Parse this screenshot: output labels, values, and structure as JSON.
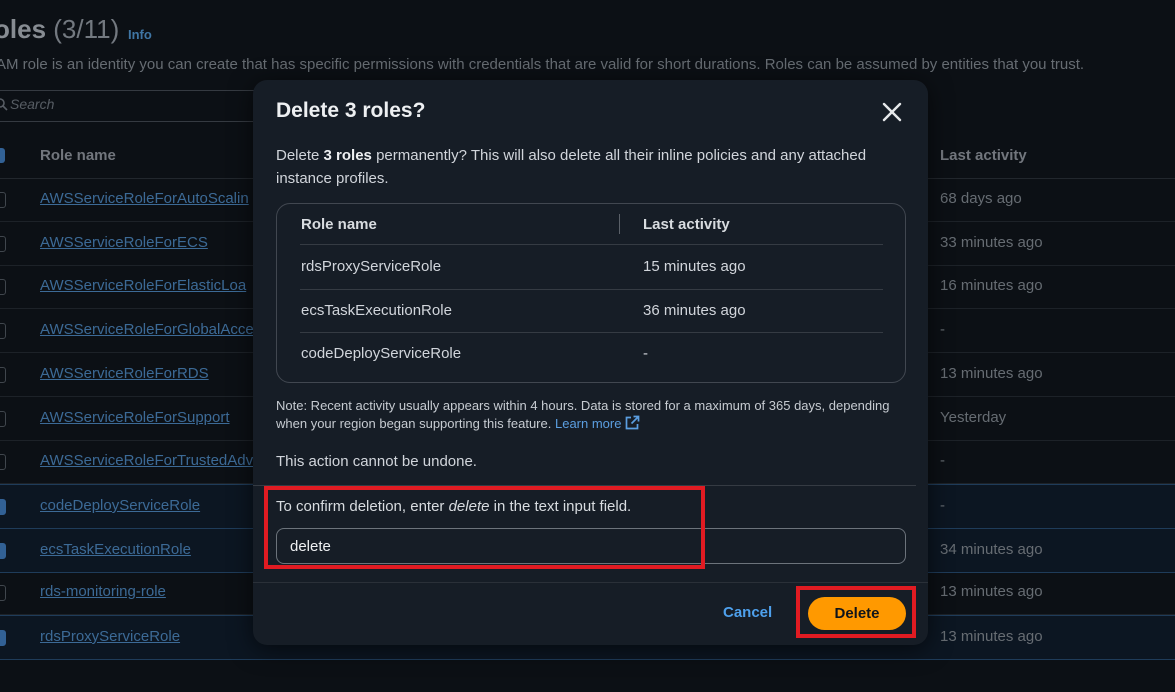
{
  "page": {
    "title": "oles",
    "count": "(3/11)",
    "info_link": "Info",
    "description": "AM role is an identity you can create that has specific permissions with credentials that are valid for short durations. Roles can be assumed by entities that you trust.",
    "search_placeholder": "Search",
    "columns": {
      "role_name": "Role name",
      "last_activity": "Last activity"
    },
    "rows": [
      {
        "name": "AWSServiceRoleForAutoScalin",
        "activity": "68 days ago",
        "selected": false
      },
      {
        "name": "AWSServiceRoleForECS",
        "activity": "33 minutes ago",
        "selected": false
      },
      {
        "name": "AWSServiceRoleForElasticLoa",
        "activity": "16 minutes ago",
        "selected": false
      },
      {
        "name": "AWSServiceRoleForGlobalAcce",
        "activity": "-",
        "selected": false
      },
      {
        "name": "AWSServiceRoleForRDS",
        "activity": "13 minutes ago",
        "selected": false
      },
      {
        "name": "AWSServiceRoleForSupport",
        "activity": "Yesterday",
        "selected": false
      },
      {
        "name": "AWSServiceRoleForTrustedAdv",
        "activity": "-",
        "selected": false
      },
      {
        "name": "codeDeployServiceRole",
        "activity": "-",
        "selected": true
      },
      {
        "name": "ecsTaskExecutionRole",
        "activity": "34 minutes ago",
        "selected": true
      },
      {
        "name": "rds-monitoring-role",
        "activity": "13 minutes ago",
        "selected": false
      },
      {
        "name": "rdsProxyServiceRole",
        "activity": "13 minutes ago",
        "selected": true
      }
    ]
  },
  "modal": {
    "title": "Delete 3 roles?",
    "body_prefix": "Delete ",
    "body_bold": "3 roles",
    "body_suffix": " permanently? This will also delete all their inline policies and any attached instance profiles.",
    "table": {
      "col_role": "Role name",
      "col_activity": "Last activity",
      "rows": [
        {
          "name": "rdsProxyServiceRole",
          "activity": "15 minutes ago"
        },
        {
          "name": "ecsTaskExecutionRole",
          "activity": "36 minutes ago"
        },
        {
          "name": "codeDeployServiceRole",
          "activity": "-"
        }
      ]
    },
    "note": "Note: Recent activity usually appears within 4 hours. Data is stored for a maximum of 365 days, depending when your region began supporting this feature.",
    "learn_more": "Learn more",
    "undone": "This action cannot be undone.",
    "confirm_prefix": "To confirm deletion, enter ",
    "confirm_word": "delete",
    "confirm_suffix": " in the text input field.",
    "input_value": "delete",
    "cancel_label": "Cancel",
    "delete_label": "Delete"
  },
  "colors": {
    "accent": "#ff9900",
    "link": "#4ea0ec",
    "highlight": "#e11b22"
  }
}
